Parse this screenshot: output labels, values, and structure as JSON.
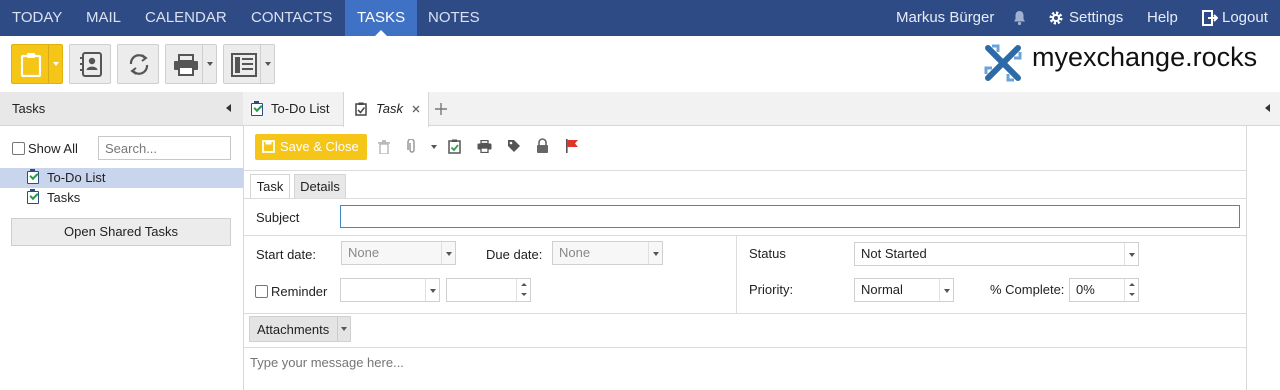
{
  "nav": {
    "items": [
      "TODAY",
      "MAIL",
      "CALENDAR",
      "CONTACTS",
      "TASKS",
      "NOTES"
    ],
    "active": "TASKS",
    "user_name": "Markus Bürger",
    "settings": "Settings",
    "help": "Help",
    "logout": "Logout"
  },
  "brand": {
    "logo_text": "myexchange.rocks",
    "accent": "#f5c518",
    "nav_color": "#2f4b86",
    "active_tab_color": "#3f71c4"
  },
  "left": {
    "header": "Tasks",
    "show_all": "Show All",
    "search_placeholder": "Search...",
    "folders": [
      {
        "label": "To-Do List",
        "selected": true
      },
      {
        "label": "Tasks",
        "selected": false
      }
    ],
    "open_shared": "Open Shared Tasks"
  },
  "tabs": [
    {
      "label": "To-Do List"
    },
    {
      "label": "Task",
      "active": true
    }
  ],
  "form": {
    "save_close": "Save & Close",
    "subtabs": [
      "Task",
      "Details"
    ],
    "subject_label": "Subject",
    "subject_value": "",
    "start_label": "Start date:",
    "start_value": "None",
    "due_label": "Due date:",
    "due_value": "None",
    "reminder_label": "Reminder",
    "status_label": "Status",
    "status_value": "Not Started",
    "priority_label": "Priority:",
    "priority_value": "Normal",
    "complete_label": "% Complete:",
    "complete_value": "0%",
    "attachments_label": "Attachments",
    "message_placeholder": "Type your message here..."
  }
}
